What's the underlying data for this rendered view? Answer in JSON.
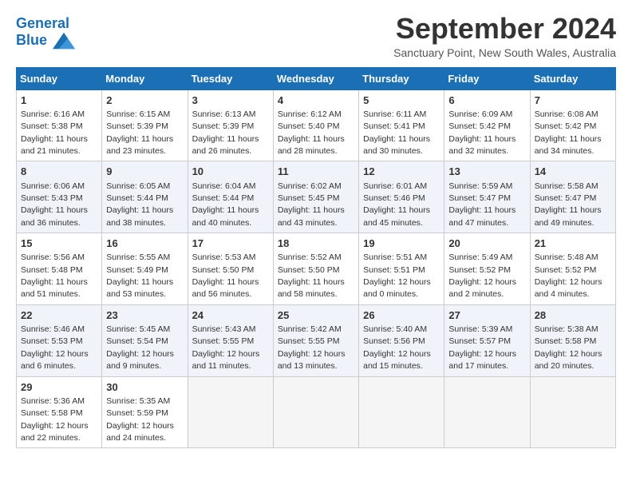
{
  "header": {
    "logo_line1": "General",
    "logo_line2": "Blue",
    "month_title": "September 2024",
    "subtitle": "Sanctuary Point, New South Wales, Australia"
  },
  "weekdays": [
    "Sunday",
    "Monday",
    "Tuesday",
    "Wednesday",
    "Thursday",
    "Friday",
    "Saturday"
  ],
  "weeks": [
    [
      {
        "day": "1",
        "sunrise": "6:16 AM",
        "sunset": "5:38 PM",
        "daylight": "11 hours and 21 minutes."
      },
      {
        "day": "2",
        "sunrise": "6:15 AM",
        "sunset": "5:39 PM",
        "daylight": "11 hours and 23 minutes."
      },
      {
        "day": "3",
        "sunrise": "6:13 AM",
        "sunset": "5:39 PM",
        "daylight": "11 hours and 26 minutes."
      },
      {
        "day": "4",
        "sunrise": "6:12 AM",
        "sunset": "5:40 PM",
        "daylight": "11 hours and 28 minutes."
      },
      {
        "day": "5",
        "sunrise": "6:11 AM",
        "sunset": "5:41 PM",
        "daylight": "11 hours and 30 minutes."
      },
      {
        "day": "6",
        "sunrise": "6:09 AM",
        "sunset": "5:42 PM",
        "daylight": "11 hours and 32 minutes."
      },
      {
        "day": "7",
        "sunrise": "6:08 AM",
        "sunset": "5:42 PM",
        "daylight": "11 hours and 34 minutes."
      }
    ],
    [
      {
        "day": "8",
        "sunrise": "6:06 AM",
        "sunset": "5:43 PM",
        "daylight": "11 hours and 36 minutes."
      },
      {
        "day": "9",
        "sunrise": "6:05 AM",
        "sunset": "5:44 PM",
        "daylight": "11 hours and 38 minutes."
      },
      {
        "day": "10",
        "sunrise": "6:04 AM",
        "sunset": "5:44 PM",
        "daylight": "11 hours and 40 minutes."
      },
      {
        "day": "11",
        "sunrise": "6:02 AM",
        "sunset": "5:45 PM",
        "daylight": "11 hours and 43 minutes."
      },
      {
        "day": "12",
        "sunrise": "6:01 AM",
        "sunset": "5:46 PM",
        "daylight": "11 hours and 45 minutes."
      },
      {
        "day": "13",
        "sunrise": "5:59 AM",
        "sunset": "5:47 PM",
        "daylight": "11 hours and 47 minutes."
      },
      {
        "day": "14",
        "sunrise": "5:58 AM",
        "sunset": "5:47 PM",
        "daylight": "11 hours and 49 minutes."
      }
    ],
    [
      {
        "day": "15",
        "sunrise": "5:56 AM",
        "sunset": "5:48 PM",
        "daylight": "11 hours and 51 minutes."
      },
      {
        "day": "16",
        "sunrise": "5:55 AM",
        "sunset": "5:49 PM",
        "daylight": "11 hours and 53 minutes."
      },
      {
        "day": "17",
        "sunrise": "5:53 AM",
        "sunset": "5:50 PM",
        "daylight": "11 hours and 56 minutes."
      },
      {
        "day": "18",
        "sunrise": "5:52 AM",
        "sunset": "5:50 PM",
        "daylight": "11 hours and 58 minutes."
      },
      {
        "day": "19",
        "sunrise": "5:51 AM",
        "sunset": "5:51 PM",
        "daylight": "12 hours and 0 minutes."
      },
      {
        "day": "20",
        "sunrise": "5:49 AM",
        "sunset": "5:52 PM",
        "daylight": "12 hours and 2 minutes."
      },
      {
        "day": "21",
        "sunrise": "5:48 AM",
        "sunset": "5:52 PM",
        "daylight": "12 hours and 4 minutes."
      }
    ],
    [
      {
        "day": "22",
        "sunrise": "5:46 AM",
        "sunset": "5:53 PM",
        "daylight": "12 hours and 6 minutes."
      },
      {
        "day": "23",
        "sunrise": "5:45 AM",
        "sunset": "5:54 PM",
        "daylight": "12 hours and 9 minutes."
      },
      {
        "day": "24",
        "sunrise": "5:43 AM",
        "sunset": "5:55 PM",
        "daylight": "12 hours and 11 minutes."
      },
      {
        "day": "25",
        "sunrise": "5:42 AM",
        "sunset": "5:55 PM",
        "daylight": "12 hours and 13 minutes."
      },
      {
        "day": "26",
        "sunrise": "5:40 AM",
        "sunset": "5:56 PM",
        "daylight": "12 hours and 15 minutes."
      },
      {
        "day": "27",
        "sunrise": "5:39 AM",
        "sunset": "5:57 PM",
        "daylight": "12 hours and 17 minutes."
      },
      {
        "day": "28",
        "sunrise": "5:38 AM",
        "sunset": "5:58 PM",
        "daylight": "12 hours and 20 minutes."
      }
    ],
    [
      {
        "day": "29",
        "sunrise": "5:36 AM",
        "sunset": "5:58 PM",
        "daylight": "12 hours and 22 minutes."
      },
      {
        "day": "30",
        "sunrise": "5:35 AM",
        "sunset": "5:59 PM",
        "daylight": "12 hours and 24 minutes."
      },
      null,
      null,
      null,
      null,
      null
    ]
  ],
  "labels": {
    "sunrise": "Sunrise: ",
    "sunset": "Sunset: ",
    "daylight": "Daylight: "
  }
}
